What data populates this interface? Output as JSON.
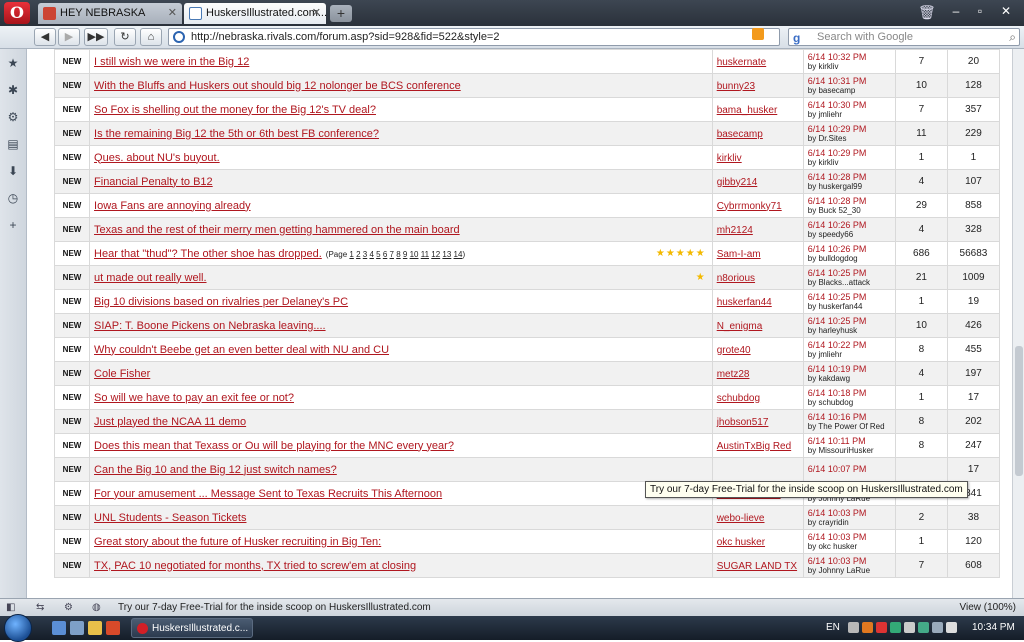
{
  "browser": {
    "tabs": [
      {
        "label": "HEY NEBRASKA",
        "active": false
      },
      {
        "label": "HuskersIllustrated.com...",
        "active": true
      }
    ],
    "url": "http://nebraska.rivals.com/forum.asp?sid=928&fid=522&style=2",
    "search_placeholder": "Search with Google",
    "status_text": "Try our 7-day Free-Trial for the inside scoop on HuskersIllustrated.com",
    "zoom": "View (100%)"
  },
  "tooltip": "Try our 7-day Free-Trial for the inside scoop on HuskersIllustrated.com",
  "forum": {
    "new_label": "NEW",
    "page_label_prefix": "(Page",
    "page_label_suffix": ")",
    "rows": [
      {
        "title": "I still wish we were in the Big 12",
        "author": "huskernate",
        "date": "6/14",
        "time": "10:32 PM",
        "by": "by kirkliv",
        "replies": "7",
        "views": "20"
      },
      {
        "title": "With the Bluffs and Huskers out should big 12 nolonger be BCS conference",
        "author": "bunny23",
        "date": "6/14",
        "time": "10:31 PM",
        "by": "by basecamp",
        "replies": "10",
        "views": "128"
      },
      {
        "title": "So Fox is shelling out the money for the Big 12's TV deal?",
        "author": "bama_husker",
        "date": "6/14",
        "time": "10:30 PM",
        "by": "by jmliehr",
        "replies": "7",
        "views": "357"
      },
      {
        "title": "Is the remaining Big 12 the 5th or 6th best FB conference?",
        "author": "basecamp",
        "date": "6/14",
        "time": "10:29 PM",
        "by": "by Dr.Sites",
        "replies": "11",
        "views": "229"
      },
      {
        "title": "Ques. about NU's buyout.",
        "author": "kirkliv",
        "date": "6/14",
        "time": "10:29 PM",
        "by": "by kirkliv",
        "replies": "1",
        "views": "1"
      },
      {
        "title": "Financial Penalty to B12",
        "author": "gibby214",
        "date": "6/14",
        "time": "10:28 PM",
        "by": "by huskergal99",
        "replies": "4",
        "views": "107"
      },
      {
        "title": "Iowa Fans are annoying already",
        "author": "Cybrrmonky71",
        "date": "6/14",
        "time": "10:28 PM",
        "by": "by Buck 52_30",
        "replies": "29",
        "views": "858"
      },
      {
        "title": "Texas and the rest of their merry men getting hammered on the main board",
        "author": "mh2124",
        "date": "6/14",
        "time": "10:26 PM",
        "by": "by speedy66",
        "replies": "4",
        "views": "328"
      },
      {
        "title": "Hear that \"thud\"? The other shoe has dropped.",
        "pages": [
          "1",
          "2",
          "3",
          "4",
          "5",
          "6",
          "7",
          "8",
          "9",
          "10",
          "11",
          "12",
          "13",
          "14"
        ],
        "stars": "★★★★★",
        "author": "Sam-I-am",
        "date": "6/14",
        "time": "10:26 PM",
        "by": "by bulldogdog",
        "replies": "686",
        "views": "56683"
      },
      {
        "title": "ut made out really well.",
        "stars": "★",
        "author": "n8orious",
        "date": "6/14",
        "time": "10:25 PM",
        "by": "by Blacks...attack",
        "replies": "21",
        "views": "1009"
      },
      {
        "title": "Big 10 divisions based on rivalries per Delaney's PC",
        "author": "huskerfan44",
        "date": "6/14",
        "time": "10:25 PM",
        "by": "by huskerfan44",
        "replies": "1",
        "views": "19"
      },
      {
        "title": "SIAP: T. Boone Pickens on Nebraska leaving....",
        "author": "N_enigma",
        "date": "6/14",
        "time": "10:25 PM",
        "by": "by harleyhusk",
        "replies": "10",
        "views": "426"
      },
      {
        "title": "Why couldn't Beebe get an even better deal with NU and CU",
        "author": "grote40",
        "date": "6/14",
        "time": "10:22 PM",
        "by": "by jmliehr",
        "replies": "8",
        "views": "455"
      },
      {
        "title": "Cole Fisher",
        "author": "metz28",
        "date": "6/14",
        "time": "10:19 PM",
        "by": "by kakdawg",
        "replies": "4",
        "views": "197"
      },
      {
        "title": "So will we have to pay an exit fee or not?",
        "author": "schubdog",
        "date": "6/14",
        "time": "10:18 PM",
        "by": "by schubdog",
        "replies": "1",
        "views": "17"
      },
      {
        "title": "Just played the NCAA 11 demo",
        "author": "jhobson517",
        "date": "6/14",
        "time": "10:16 PM",
        "by": "by The Power Of Red",
        "replies": "8",
        "views": "202"
      },
      {
        "title": "Does this mean that Texass or Ou will be playing for the MNC every year?",
        "author": "AustinTxBig Red",
        "date": "6/14",
        "time": "10:11 PM",
        "by": "by MissouriHusker",
        "replies": "8",
        "views": "247"
      },
      {
        "title": "Can the Big 10 and the Big 12 just switch names?",
        "author": "",
        "date": "6/14",
        "time": "10:07 PM",
        "by": "",
        "replies": "",
        "views": "17"
      },
      {
        "title": "For your amusement ... Message Sent to Texas Recruits This Afternoon",
        "author": "CarmelHusker",
        "date": "6/14",
        "time": "10:07 PM",
        "by": "by Johnny LaRue",
        "replies": "5",
        "views": "841"
      },
      {
        "title": "UNL Students - Season Tickets",
        "author": "webo-lieve",
        "date": "6/14",
        "time": "10:03 PM",
        "by": "by crayridin",
        "replies": "2",
        "views": "38"
      },
      {
        "title": "Great story about the future of Husker recruiting in Big Ten:",
        "author": "okc husker",
        "date": "6/14",
        "time": "10:03 PM",
        "by": "by okc husker",
        "replies": "1",
        "views": "120"
      },
      {
        "title": "TX, PAC 10 negotiated for months, TX tried to screw'em at closing",
        "author": "SUGAR LAND TX",
        "date": "6/14",
        "time": "10:03 PM",
        "by": "by Johnny LaRue",
        "replies": "7",
        "views": "608"
      }
    ]
  },
  "taskbar": {
    "task_label": "HuskersIllustrated.c...",
    "lang": "EN",
    "clock": "10:34 PM"
  },
  "colors": {
    "link": "#b0171f",
    "star": "#f3b900",
    "alt_row": "#f1f1f1"
  }
}
